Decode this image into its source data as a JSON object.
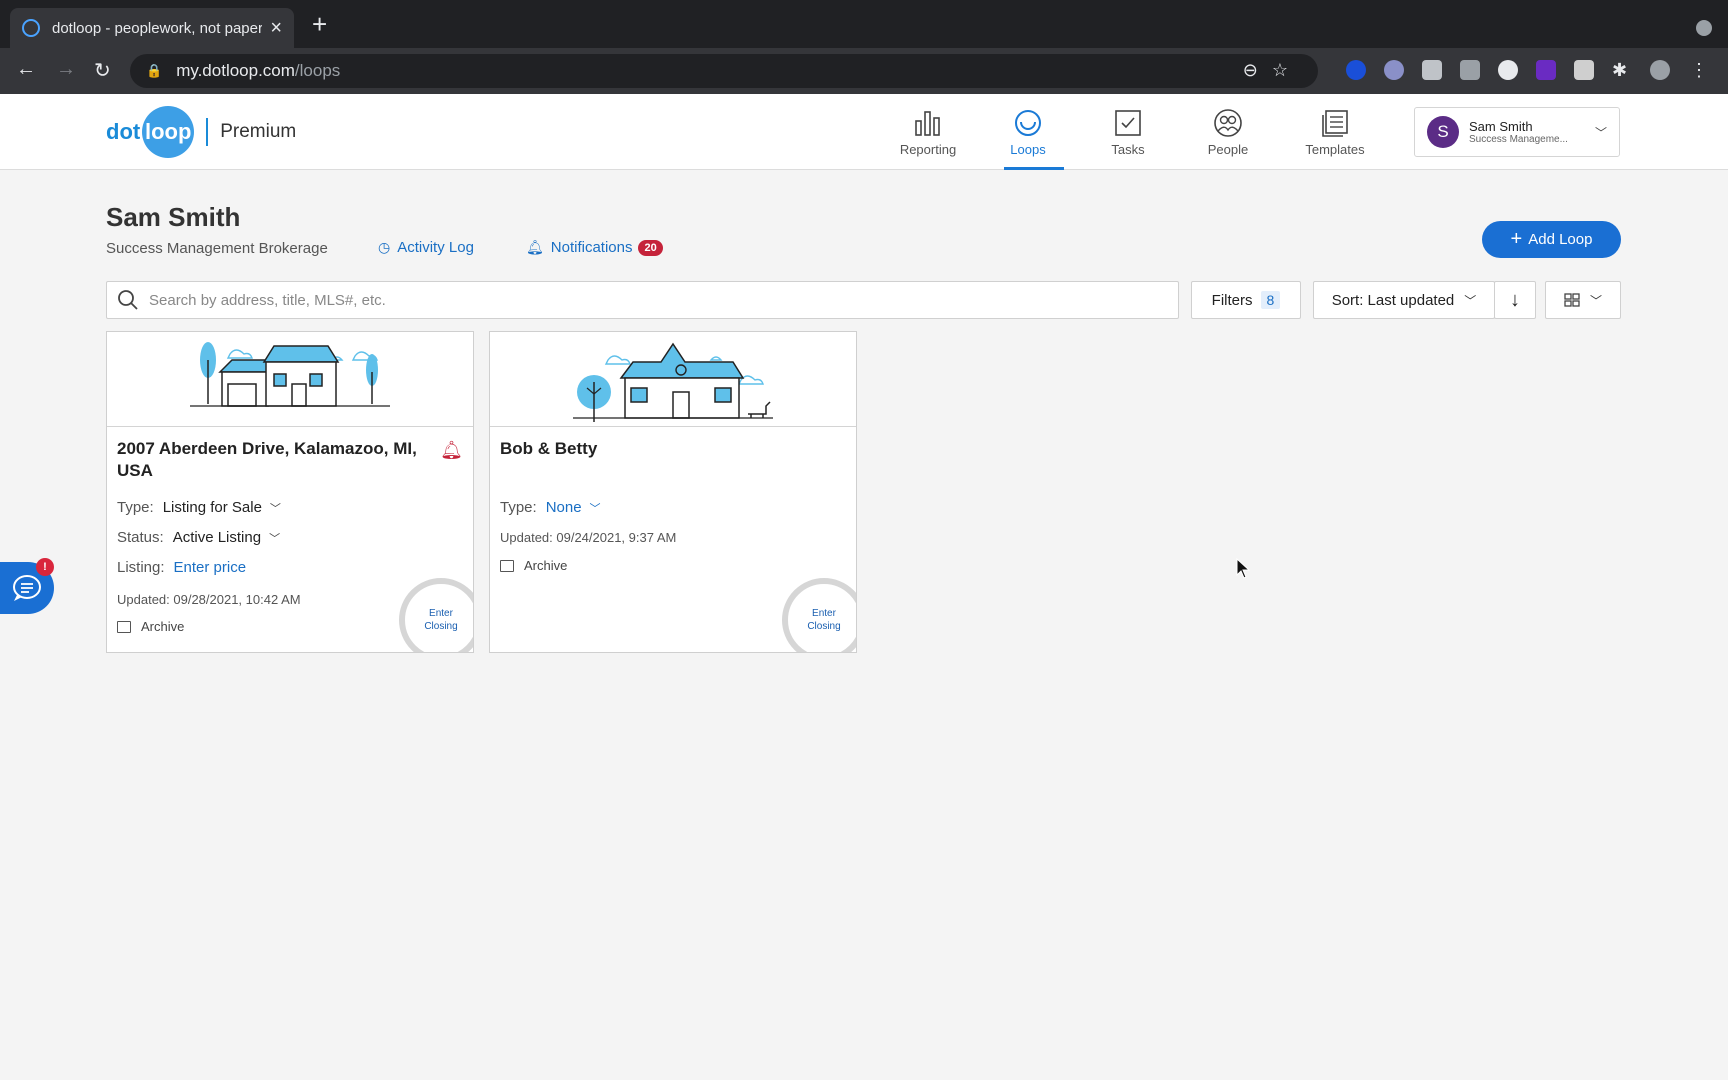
{
  "browser": {
    "tab_title": "dotloop - peoplework, not paperwork",
    "new_tab_label": "+",
    "url_host": "my.dotloop.com",
    "url_path": "/loops"
  },
  "header": {
    "logo_dot": "dot",
    "logo_loop": "loop",
    "plan": "Premium",
    "nav": [
      {
        "label": "Reporting",
        "icon": "bar-chart-icon"
      },
      {
        "label": "Loops",
        "icon": "loop-icon",
        "active": true
      },
      {
        "label": "Tasks",
        "icon": "checkbox-icon"
      },
      {
        "label": "People",
        "icon": "people-icon"
      },
      {
        "label": "Templates",
        "icon": "templates-icon"
      }
    ],
    "user": {
      "initial": "S",
      "name": "Sam Smith",
      "org": "Success Manageme..."
    }
  },
  "page": {
    "title": "Sam Smith",
    "brokerage": "Success Management Brokerage",
    "activity_log": "Activity Log",
    "notifications": "Notifications",
    "notifications_count": "20",
    "add_loop": "Add Loop"
  },
  "search": {
    "placeholder": "Search by address, title, MLS#, etc."
  },
  "controls": {
    "filters_label": "Filters",
    "filters_count": "8",
    "sort_label": "Sort: Last updated"
  },
  "loops": [
    {
      "title": "2007 Aberdeen Drive, Kalamazoo, MI, USA",
      "type_label": "Type:",
      "type_value": "Listing for Sale",
      "status_label": "Status:",
      "status_value": "Active Listing",
      "listing_label": "Listing:",
      "listing_value": "Enter price",
      "updated": "Updated: 09/28/2021, 10:42 AM",
      "archive": "Archive",
      "closing_line1": "Enter",
      "closing_line2": "Closing"
    },
    {
      "title": "Bob & Betty",
      "type_label": "Type:",
      "type_value": "None",
      "updated": "Updated: 09/24/2021, 9:37 AM",
      "archive": "Archive",
      "closing_line1": "Enter",
      "closing_line2": "Closing"
    }
  ],
  "chat": {
    "badge": "!"
  },
  "colors": {
    "brand_blue": "#1a6fd3",
    "notification_red": "#c5233a",
    "avatar_purple": "#5b2c86"
  }
}
